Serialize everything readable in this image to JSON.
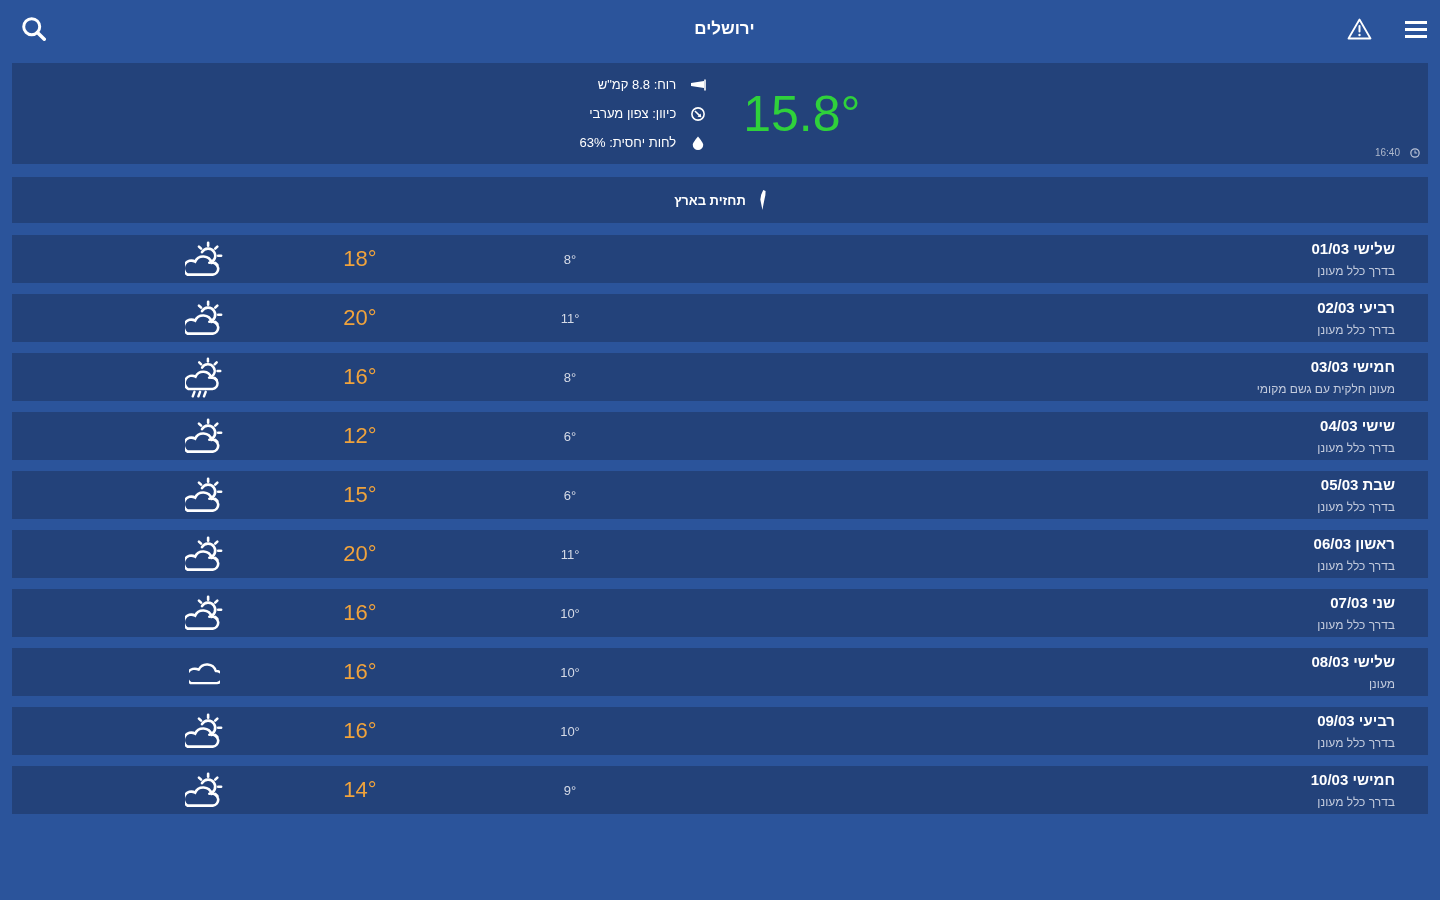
{
  "header": {
    "title": "ירושלים"
  },
  "current": {
    "temperature": "15.8°",
    "details": [
      {
        "kind": "wind",
        "text": "רוח: 8.8 קמ\"ש"
      },
      {
        "kind": "direction",
        "text": "כיוון: צפון מערבי"
      },
      {
        "kind": "humidity",
        "text": "לחות יחסית: 63%"
      }
    ],
    "updated": "16:40"
  },
  "country_forecast": {
    "label": "תחזית בארץ"
  },
  "days": [
    {
      "title": "שלישי 01/03",
      "description": "בדרך כלל מעונן",
      "min": "8°",
      "max": "18°",
      "kind": "partly_cloudy"
    },
    {
      "title": "רביעי 02/03",
      "description": "בדרך כלל מעונן",
      "min": "11°",
      "max": "20°",
      "kind": "partly_cloudy"
    },
    {
      "title": "חמישי 03/03",
      "description": "מעונן חלקית עם גשם מקומי",
      "min": "8°",
      "max": "16°",
      "kind": "rain"
    },
    {
      "title": "שישי 04/03",
      "description": "בדרך כלל מעונן",
      "min": "6°",
      "max": "12°",
      "kind": "partly_cloudy"
    },
    {
      "title": "שבת 05/03",
      "description": "בדרך כלל מעונן",
      "min": "6°",
      "max": "15°",
      "kind": "partly_cloudy"
    },
    {
      "title": "ראשון 06/03",
      "description": "בדרך כלל מעונן",
      "min": "11°",
      "max": "20°",
      "kind": "partly_cloudy"
    },
    {
      "title": "שני 07/03",
      "description": "בדרך כלל מעונן",
      "min": "10°",
      "max": "16°",
      "kind": "partly_cloudy"
    },
    {
      "title": "שלישי 08/03",
      "description": "מעונן",
      "min": "10°",
      "max": "16°",
      "kind": "cloudy"
    },
    {
      "title": "רביעי 09/03",
      "description": "בדרך כלל מעונן",
      "min": "10°",
      "max": "16°",
      "kind": "partly_cloudy"
    },
    {
      "title": "חמישי 10/03",
      "description": "בדרך כלל מעונן",
      "min": "9°",
      "max": "14°",
      "kind": "partly_cloudy"
    }
  ]
}
